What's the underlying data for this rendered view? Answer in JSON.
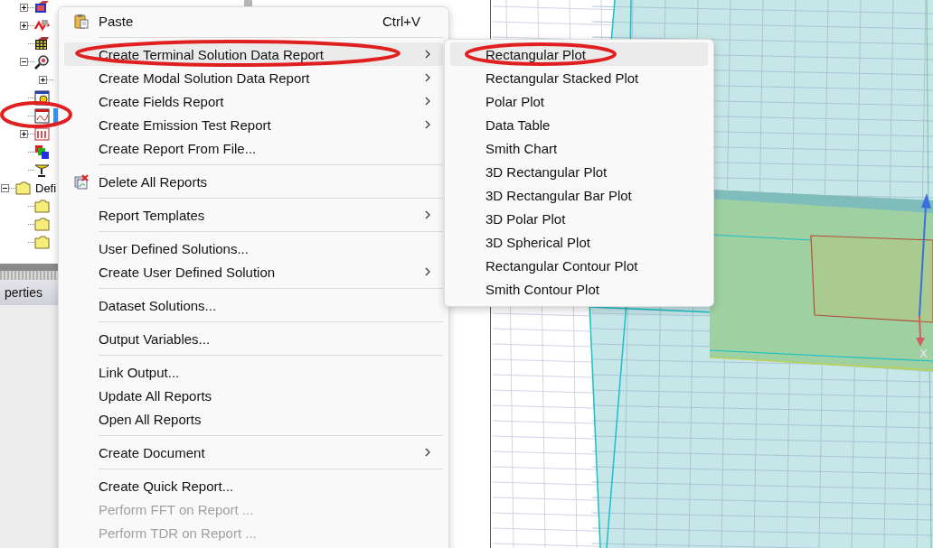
{
  "tree": {
    "continued_items": [
      {
        "kind": "boundary",
        "expanded": false,
        "selected": false
      },
      {
        "kind": "excitation",
        "expanded": false,
        "selected": false
      },
      {
        "kind": "mesh",
        "selected": false
      },
      {
        "kind": "analysis",
        "expanded": true,
        "selected": false,
        "children": [
          {
            "expanded": false,
            "selected": false
          }
        ]
      },
      {
        "kind": "optimetrics",
        "selected": false
      },
      {
        "kind": "results",
        "selected": true
      },
      {
        "kind": "port-field",
        "expanded": false,
        "selected": false
      },
      {
        "kind": "field-overlay",
        "selected": false
      },
      {
        "kind": "radiation",
        "selected": false
      }
    ],
    "items": [
      {
        "kind": "folder",
        "label": "Defi",
        "expanded": true,
        "selected": false,
        "children": [
          {
            "kind": "folder",
            "selected": false
          },
          {
            "kind": "folder",
            "selected": false
          },
          {
            "kind": "folder",
            "selected": false
          }
        ]
      }
    ]
  },
  "properties": {
    "tab": "perties"
  },
  "context_menu": {
    "items": [
      {
        "kind": "item",
        "label": "Paste",
        "shortcut": "Ctrl+V",
        "icon": true,
        "submenu": false,
        "selected": false,
        "disabled": false
      },
      {
        "kind": "separator"
      },
      {
        "kind": "item",
        "label": "Create Terminal Solution Data Report",
        "icon": false,
        "submenu": true,
        "selected": true,
        "disabled": false
      },
      {
        "kind": "item",
        "label": "Create Modal Solution Data Report",
        "icon": false,
        "submenu": true,
        "selected": false,
        "disabled": false
      },
      {
        "kind": "item",
        "label": "Create Fields Report",
        "icon": false,
        "submenu": true,
        "selected": false,
        "disabled": false
      },
      {
        "kind": "item",
        "label": "Create Emission Test Report",
        "icon": false,
        "submenu": true,
        "selected": false,
        "disabled": false
      },
      {
        "kind": "item",
        "label": "Create Report From File...",
        "icon": false,
        "submenu": false,
        "selected": false,
        "disabled": false
      },
      {
        "kind": "separator"
      },
      {
        "kind": "item",
        "label": "Delete All Reports",
        "icon": true,
        "submenu": false,
        "selected": false,
        "disabled": false
      },
      {
        "kind": "separator"
      },
      {
        "kind": "item",
        "label": "Report Templates",
        "icon": false,
        "submenu": true,
        "selected": false,
        "disabled": false
      },
      {
        "kind": "separator"
      },
      {
        "kind": "item",
        "label": "User Defined Solutions...",
        "icon": false,
        "submenu": false,
        "selected": false,
        "disabled": false
      },
      {
        "kind": "item",
        "label": "Create User Defined Solution",
        "icon": false,
        "submenu": true,
        "selected": false,
        "disabled": false
      },
      {
        "kind": "separator"
      },
      {
        "kind": "item",
        "label": "Dataset Solutions...",
        "icon": false,
        "submenu": false,
        "selected": false,
        "disabled": false
      },
      {
        "kind": "separator"
      },
      {
        "kind": "item",
        "label": "Output Variables...",
        "icon": false,
        "submenu": false,
        "selected": false,
        "disabled": false
      },
      {
        "kind": "separator"
      },
      {
        "kind": "item",
        "label": "Link Output...",
        "icon": false,
        "submenu": false,
        "selected": false,
        "disabled": false
      },
      {
        "kind": "item",
        "label": "Update All Reports",
        "icon": false,
        "submenu": false,
        "selected": false,
        "disabled": false
      },
      {
        "kind": "item",
        "label": "Open All Reports",
        "icon": false,
        "submenu": false,
        "selected": false,
        "disabled": false
      },
      {
        "kind": "separator"
      },
      {
        "kind": "item",
        "label": "Create Document",
        "icon": false,
        "submenu": true,
        "selected": false,
        "disabled": false
      },
      {
        "kind": "separator"
      },
      {
        "kind": "item",
        "label": "Create Quick Report...",
        "icon": false,
        "submenu": false,
        "selected": false,
        "disabled": false
      },
      {
        "kind": "item",
        "label": "Perform FFT on Report ...",
        "icon": false,
        "submenu": false,
        "selected": false,
        "disabled": true
      },
      {
        "kind": "item",
        "label": "Perform TDR on Report ...",
        "icon": false,
        "submenu": false,
        "selected": false,
        "disabled": true
      }
    ]
  },
  "submenu": {
    "items": [
      {
        "label": "Rectangular Plot",
        "selected": true
      },
      {
        "label": "Rectangular Stacked Plot",
        "selected": false
      },
      {
        "label": "Polar Plot",
        "selected": false
      },
      {
        "label": "Data Table",
        "selected": false
      },
      {
        "label": "Smith Chart",
        "selected": false
      },
      {
        "label": "3D Rectangular Plot",
        "selected": false
      },
      {
        "label": "3D Rectangular Bar Plot",
        "selected": false
      },
      {
        "label": "3D Polar Plot",
        "selected": false
      },
      {
        "label": "3D Spherical Plot",
        "selected": false
      },
      {
        "label": "Rectangular Contour Plot",
        "selected": false
      },
      {
        "label": "Smith Contour Plot",
        "selected": false
      }
    ]
  },
  "view": {
    "axis_labels": [
      "X"
    ]
  }
}
